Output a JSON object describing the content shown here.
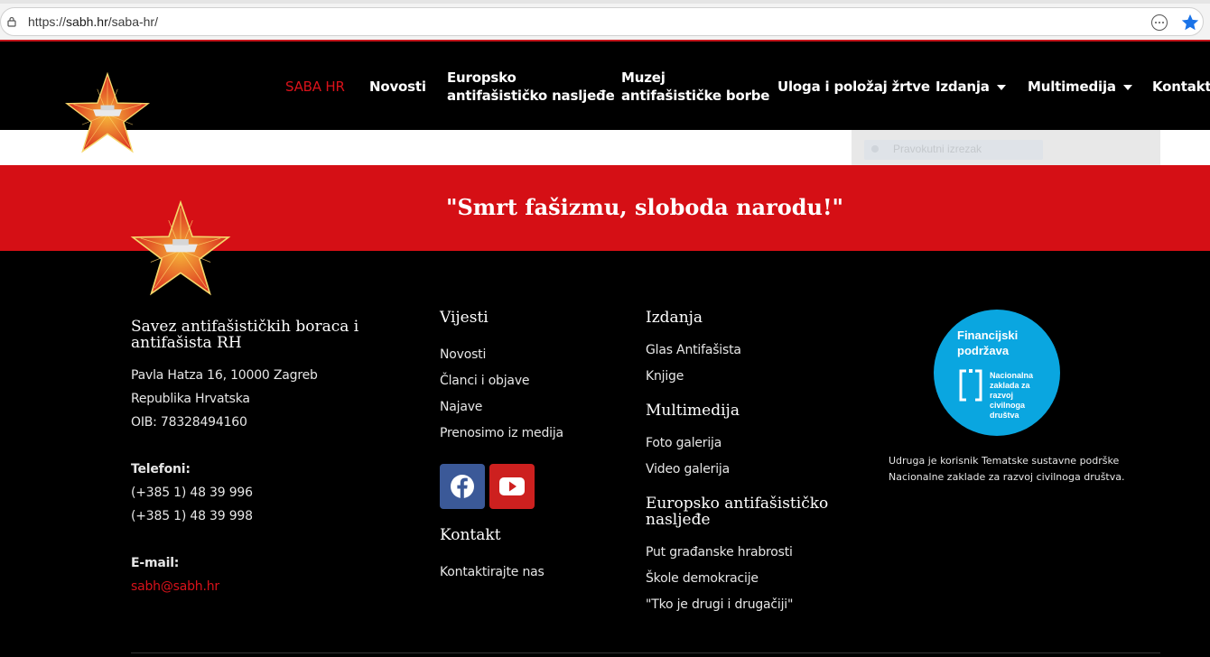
{
  "browser": {
    "url_protocol": "https://",
    "url_host": "sabh.hr",
    "url_path": "/saba-hr/"
  },
  "nav": {
    "items": [
      {
        "label": "SABA HR",
        "active": true
      },
      {
        "label": "Novosti"
      },
      {
        "label_line1": "Europsko",
        "label_line2": "antifašističko nasljeđe"
      },
      {
        "label_line1": "Muzej",
        "label_line2": "antifašističke borbe"
      },
      {
        "label": "Uloga i položaj žrtve"
      },
      {
        "label": "Izdanja",
        "dropdown": true
      },
      {
        "label": "Multimedija",
        "dropdown": true
      },
      {
        "label": "Kontakt"
      }
    ]
  },
  "sidebar_widget": {
    "faded_option": "Pravokutni izrezak"
  },
  "banner": {
    "quote": "\"Smrt fašizmu, sloboda narodu!\""
  },
  "footer": {
    "org": {
      "name_line1": "Savez antifašističkih boraca i",
      "name_line2": "antifašista RH",
      "address_line1": "Pavla Hatza 16, 10000 Zagreb",
      "address_line2": "Republika Hrvatska",
      "oib": "OIB: 78328494160",
      "phones_label": "Telefoni:",
      "phone1": "(+385 1) 48 39 996",
      "phone2": "(+385 1) 48 39 998",
      "email_label": "E-mail:",
      "email": "sabh@sabh.hr"
    },
    "vijesti": {
      "heading": "Vijesti",
      "links": [
        "Novosti",
        "Članci i objave",
        "Najave",
        "Prenosimo iz medija"
      ]
    },
    "kontakt": {
      "heading": "Kontakt",
      "links": [
        "Kontaktirajte nas"
      ]
    },
    "izdanja": {
      "heading": "Izdanja",
      "links": [
        "Glas Antifašista",
        "Knjige"
      ]
    },
    "multimedija": {
      "heading": "Multimedija",
      "links": [
        "Foto galerija",
        "Video galerija"
      ]
    },
    "europsko": {
      "heading_line1": "Europsko antifašističko",
      "heading_line2": "nasljeđe",
      "links": [
        "Put građanske hrabrosti",
        "Škole demokracije",
        "\"Tko je drugi i drugačiji\""
      ]
    },
    "badge": {
      "line1": "Financijski",
      "line2": "podržava",
      "org_line1": "Nacionalna",
      "org_line2": "zaklada za",
      "org_line3": "razvoj",
      "org_line4": "civilnoga",
      "org_line5": "društva"
    },
    "support_text": "Udruga je korisnik Tematske sustavne podrške Nacionalne zaklade za razvoj civilnoga društva."
  },
  "colors": {
    "brand_red": "#d50f15",
    "background": "#000000",
    "badge_blue": "#0aa6e0",
    "facebook": "#3b5998",
    "youtube": "#cd201f"
  }
}
